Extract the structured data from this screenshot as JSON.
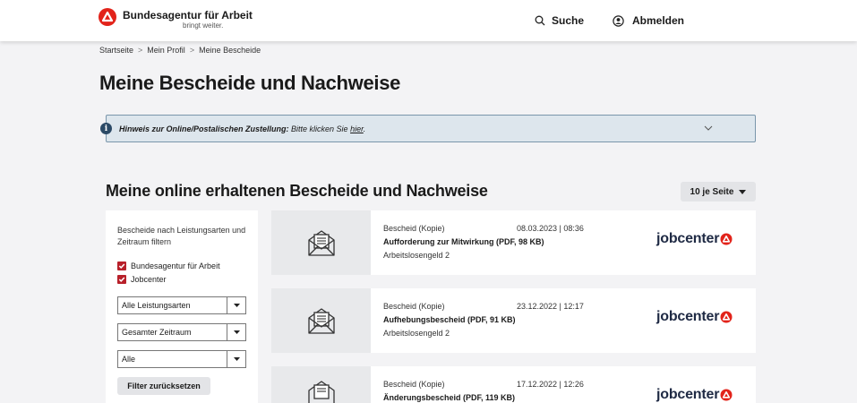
{
  "header": {
    "brand_name": "Bundesagentur für Arbeit",
    "brand_tagline": "bringt weiter.",
    "search_label": "Suche",
    "logout_label": "Abmelden",
    "brand_color": "#e2231a"
  },
  "breadcrumb": {
    "items": [
      "Startseite",
      "Mein Profil",
      "Meine Bescheide"
    ],
    "separator": ">"
  },
  "page_title": "Meine Bescheide und Nachweise",
  "notice": {
    "bold_text": "Hinweis zur Online/Postalischen Zustellung:",
    "text": " Bitte klicken Sie ",
    "link_text": "hier",
    "end": "."
  },
  "section": {
    "title": "Meine online erhaltenen Bescheide und Nachweise",
    "per_page_label": "10 je Seite"
  },
  "filter": {
    "title": "Bescheide nach Leistungsarten und Zeitraum filtern",
    "checkboxes": [
      {
        "label": "Bundesagentur für Arbeit",
        "checked": true
      },
      {
        "label": "Jobcenter",
        "checked": true
      }
    ],
    "selects": [
      "Alle Leistungsarten",
      "Gesamter Zeitraum",
      "Alle"
    ],
    "reset_label": "Filter zurücksetzen"
  },
  "documents": [
    {
      "kind": "Bescheid (Kopie)",
      "date": "08.03.2023 | 08:36",
      "name": "Aufforderung zur Mitwirkung (PDF, 98 KB)",
      "benefit": "Arbeitslosengeld 2",
      "issuer": "jobcenter"
    },
    {
      "kind": "Bescheid (Kopie)",
      "date": "23.12.2022 | 12:17",
      "name": "Aufhebungsbescheid (PDF, 91 KB)",
      "benefit": "Arbeitslosengeld 2",
      "issuer": "jobcenter"
    },
    {
      "kind": "Bescheid (Kopie)",
      "date": "17.12.2022 | 12:26",
      "name": "Änderungsbescheid (PDF, 119 KB)",
      "benefit": "",
      "issuer": "jobcenter"
    }
  ],
  "icons": [
    "ba-logo-icon",
    "search-icon",
    "user-circle-icon",
    "info-icon",
    "chevron-down-icon",
    "caret-down-icon",
    "checkbox-checked-icon",
    "envelope-document-icon",
    "jobcenter-logo-icon"
  ]
}
